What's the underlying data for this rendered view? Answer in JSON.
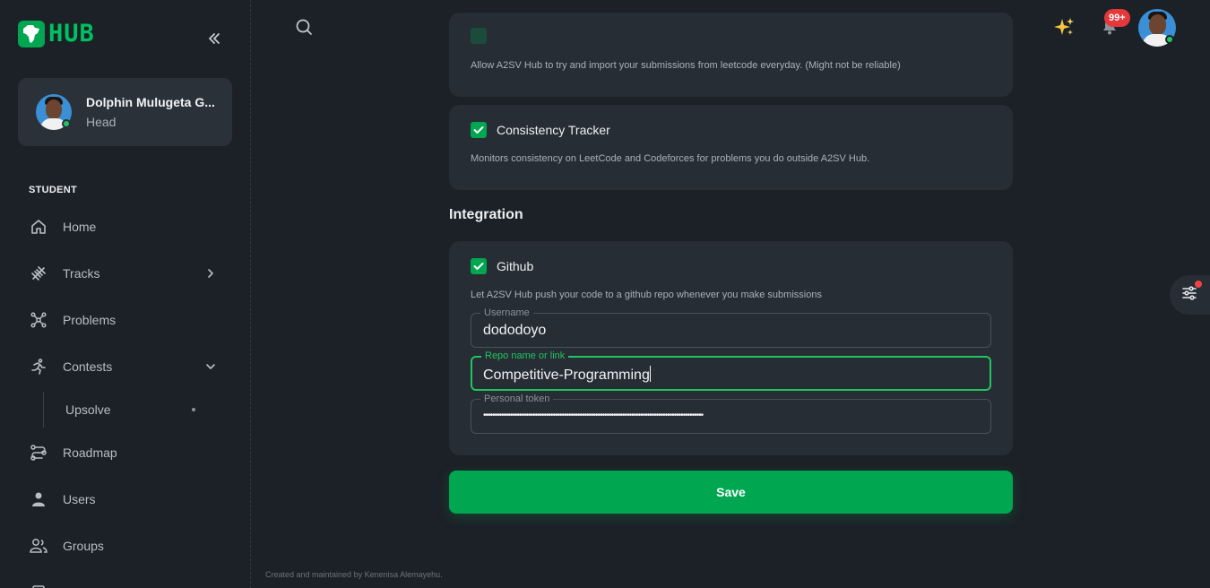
{
  "brand": {
    "name": "HUB",
    "accent": "#00a650"
  },
  "user": {
    "name": "Dolphin Mulugeta G...",
    "role": "Head"
  },
  "sidebar": {
    "section": "STUDENT",
    "items": [
      {
        "label": "Home",
        "icon": "home-icon"
      },
      {
        "label": "Tracks",
        "icon": "tracks-icon"
      },
      {
        "label": "Problems",
        "icon": "problems-icon"
      },
      {
        "label": "Contests",
        "icon": "contests-icon"
      },
      {
        "label": "Upsolve"
      },
      {
        "label": "Roadmap",
        "icon": "roadmap-icon"
      },
      {
        "label": "Users",
        "icon": "user-icon"
      },
      {
        "label": "Groups",
        "icon": "groups-icon"
      }
    ]
  },
  "header": {
    "notifications_badge": "99+"
  },
  "settings": {
    "leetcode_import": {
      "description": "Allow A2SV Hub to try and import your submissions from leetcode everyday. (Might not be reliable)"
    },
    "consistency": {
      "label": "Consistency Tracker",
      "description": "Monitors consistency on LeetCode and Codeforces for problems you do outside A2SV Hub.",
      "checked": true
    },
    "integration_title": "Integration",
    "github": {
      "label": "Github",
      "checked": true,
      "description": "Let A2SV Hub push your code to a github repo whenever you make submissions",
      "username_label": "Username",
      "username_value": "dododoyo",
      "repo_label": "Repo name or link",
      "repo_value": "Competitive-Programming",
      "token_label": "Personal token",
      "token_value": "••••••••••••••••••••••••••••••••••••••••••••••••••••••••••••••••••••••••••••••••••••••••••••••••••"
    },
    "save_label": "Save"
  },
  "footer": "Created and maintained by Kenenisa Alemayehu."
}
